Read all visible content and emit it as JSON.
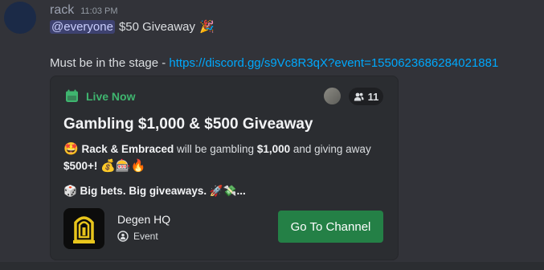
{
  "message": {
    "username": "rack",
    "timestamp": "11:03 PM",
    "mention": "@everyone",
    "title_text": "$50 Giveaway",
    "party_emoji": "🎉",
    "stage_text": "Must be in the stage - ",
    "link": "https://discord.gg/s9Vc8R3qX?event=1550623686284021881"
  },
  "event": {
    "status": "Live Now",
    "interested_count": "11",
    "title": "Gambling $1,000 & $500 Giveaway",
    "desc_emoji": "🤩",
    "desc_hosts": "Rack & Embraced",
    "desc_mid": " will be gambling ",
    "desc_amount": "$1,000",
    "desc_after": " and giving away",
    "desc_prize": "$500+!",
    "desc_emojis": "💰🎰🔥",
    "desc2": "🎲 Big bets. Big giveaways. 🚀💸...",
    "server_name": "Degen HQ",
    "event_type": "Event",
    "button_label": "Go To Channel"
  },
  "colors": {
    "live_green": "#3fb56f",
    "button_green": "#248046",
    "link_blue": "#00a8fc",
    "mention_bg": "#3e4270"
  }
}
